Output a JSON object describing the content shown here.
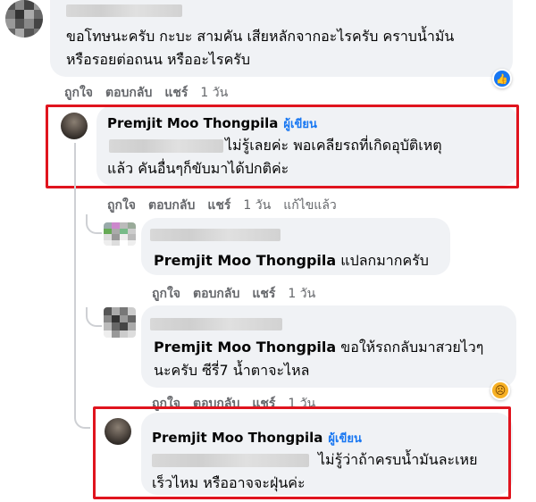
{
  "comment1": {
    "text_line1": "ขอโทษนะครับ กะบะ สามคัน เสียหลักจากอะไรครับ คราบน้ำมัน",
    "text_line2": "หรือรอยต่อถนน หรืออะไรครับ",
    "like": "ถูกใจ",
    "reply": "ตอบกลับ",
    "share": "แชร์",
    "time": "1 วัน",
    "reaction_icon": "like-icon"
  },
  "reply1": {
    "author": "Premjit Moo Thongpila",
    "badge": "ผู้เขียน",
    "text_line1": "ไม่รู้เลยค่ะ พอเคลียรถที่เกิดอุบัติเหตุ",
    "text_line2": "แล้ว คันอื่นๆก็ขับมาได้ปกติค่ะ",
    "like": "ถูกใจ",
    "reply": "ตอบกลับ",
    "share": "แชร์",
    "time": "1 วัน",
    "edited": "แก้ไขแล้ว"
  },
  "reply2": {
    "author": "Premjit Moo Thongpila",
    "text": "แปลกมากครับ",
    "like": "ถูกใจ",
    "reply": "ตอบกลับ",
    "share": "แชร์",
    "time": "1 วัน"
  },
  "reply3": {
    "author": "Premjit Moo Thongpila",
    "text_line1": "ขอให้รถกลับมาสวยไวๆ",
    "text_line2": "นะครับ ซีรี่7 น้ำตาจะไหล",
    "like": "ถูกใจ",
    "reply": "ตอบกลับ",
    "share": "แชร์",
    "time": "1 วัน",
    "reaction_icon": "sad-face-icon"
  },
  "reply4": {
    "author": "Premjit Moo Thongpila",
    "badge": "ผู้เขียน",
    "text_line1": "ไม่รู้ว่าถ้าครบน้ำมันละเหย",
    "text_line2": "เร็วไหม หรืออาจจะฝุ่นค่ะ"
  },
  "colors": {
    "highlight": "#e0141e",
    "badge": "#1877f2",
    "bubble": "#f0f2f5",
    "meta": "#65676b"
  }
}
